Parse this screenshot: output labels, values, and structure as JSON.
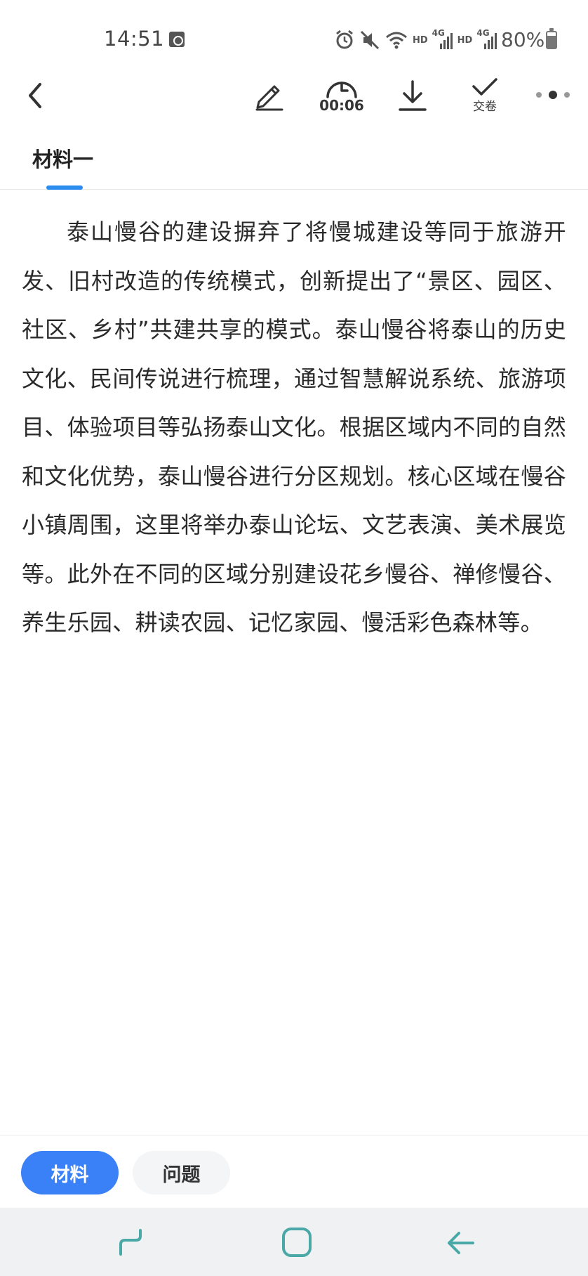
{
  "status_bar": {
    "time": "14:51",
    "battery": "80%",
    "signal_labels": [
      "HD",
      "4G",
      "HD",
      "4G"
    ],
    "icons": [
      "alarm-icon",
      "mute-icon",
      "wifi-icon",
      "signal-icon",
      "signal-icon",
      "battery-icon"
    ]
  },
  "toolbar": {
    "timer": "00:06",
    "submit_label": "交卷",
    "icons": [
      "back-icon",
      "pencil-icon",
      "timer-icon",
      "download-icon",
      "check-icon",
      "more-icon"
    ]
  },
  "tab": {
    "label": "材料一"
  },
  "material": {
    "text": "泰山慢谷的建设摒弃了将慢城建设等同于旅游开发、旧村改造的传统模式，创新提出了“景区、园区、社区、乡村”共建共享的模式。泰山慢谷将泰山的历史文化、民间传说进行梳理，通过智慧解说系统、旅游项目、体验项目等弘扬泰山文化。根据区域内不同的自然和文化优势，泰山慢谷进行分区规划。核心区域在慢谷小镇周围，这里将举办泰山论坛、文艺表演、美术展览等。此外在不同的区域分别建设花乡慢谷、禅修慢谷、养生乐园、耕读农园、记忆家园、慢活彩色森林等。"
  },
  "bottom_tabs": {
    "material": "材料",
    "question": "问题"
  },
  "colors": {
    "accent": "#3a80f6",
    "tab_indicator": "#2b8cf0",
    "nav_icon": "#4aa9a6"
  }
}
